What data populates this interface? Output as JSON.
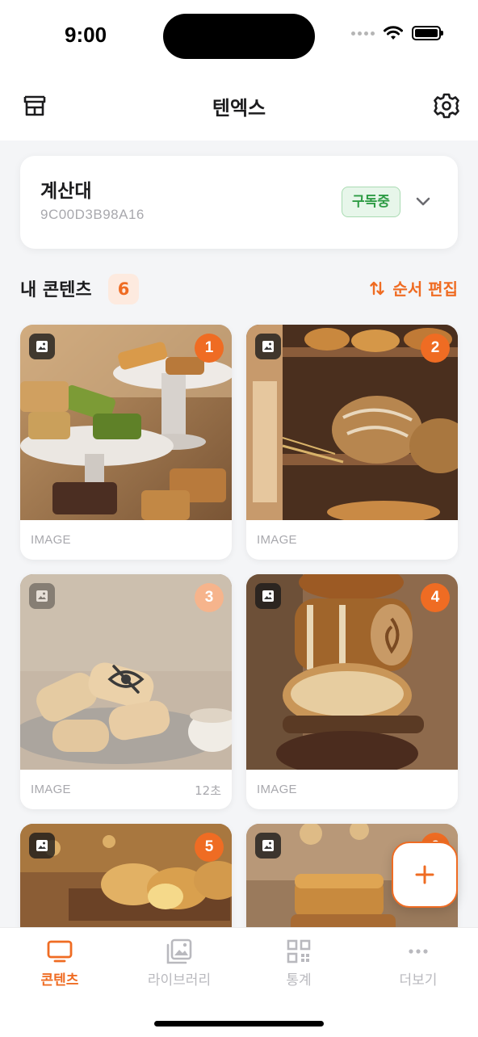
{
  "status_bar": {
    "time": "9:00"
  },
  "header": {
    "title": "텐엑스",
    "left_icon": "store-icon",
    "right_icon": "gear-icon"
  },
  "device": {
    "name": "계산대",
    "id": "9C00D3B98A16",
    "badge": "구독중"
  },
  "section": {
    "title": "내 콘텐츠",
    "count": "6",
    "reorder_label": "순서 편집"
  },
  "contents": [
    {
      "order": "1",
      "type": "IMAGE",
      "duration": "",
      "hidden": false,
      "scene": "financier-stands"
    },
    {
      "order": "2",
      "type": "IMAGE",
      "duration": "",
      "hidden": false,
      "scene": "bread-shelf"
    },
    {
      "order": "3",
      "type": "IMAGE",
      "duration": "12초",
      "hidden": true,
      "scene": "madeleines"
    },
    {
      "order": "4",
      "type": "IMAGE",
      "duration": "",
      "hidden": false,
      "scene": "bread-stack"
    },
    {
      "order": "5",
      "type": "IMAGE",
      "duration": "",
      "hidden": false,
      "scene": "cream-buns"
    },
    {
      "order": "6",
      "type": "IMAGE",
      "duration": "",
      "hidden": false,
      "scene": "pound-cake"
    }
  ],
  "tabs": [
    {
      "label": "콘텐츠",
      "icon": "monitor-icon",
      "active": true
    },
    {
      "label": "라이브러리",
      "icon": "gallery-icon",
      "active": false
    },
    {
      "label": "통계",
      "icon": "qr-code-icon",
      "active": false
    },
    {
      "label": "더보기",
      "icon": "more-dots-icon",
      "active": false
    }
  ],
  "colors": {
    "accent": "#ef6c23",
    "success": "#2e9c45"
  }
}
